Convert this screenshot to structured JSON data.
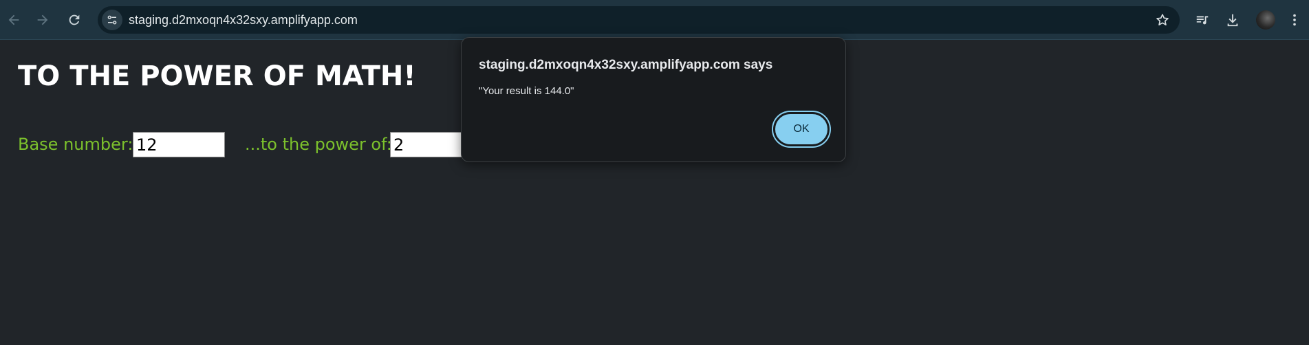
{
  "browser": {
    "url": "staging.d2mxoqn4x32sxy.amplifyapp.com",
    "icons": [
      "back-icon",
      "forward-icon",
      "reload-icon",
      "site-info-icon",
      "bookmark-star-icon",
      "media-playlist-icon",
      "download-icon",
      "profile-avatar",
      "menu-kebab-icon"
    ]
  },
  "page": {
    "title": "TO THE POWER OF MATH!",
    "base_label": "Base number:",
    "base_value": "12",
    "power_label": "...to the power of:",
    "power_value": "2"
  },
  "dialog": {
    "title": "staging.d2mxoqn4x32sxy.amplifyapp.com says",
    "message": "\"Your result is 144.0\"",
    "ok_label": "OK"
  },
  "colors": {
    "page_background": "#212529",
    "label_green": "#7cc12c",
    "ok_button": "#87cff0",
    "toolbar": "#1f3440"
  }
}
